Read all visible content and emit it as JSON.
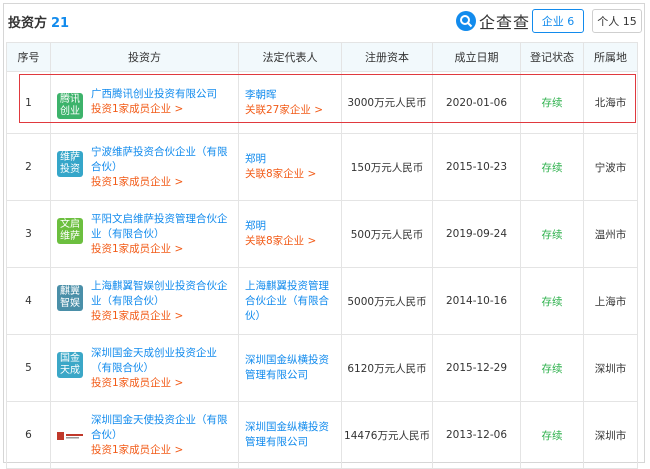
{
  "header": {
    "title": "投资方",
    "count": "21",
    "brand_text": "企查查",
    "tab_company": "企业 6",
    "tab_person": "个人 15"
  },
  "columns": [
    "序号",
    "投资方",
    "法定代表人",
    "注册资本",
    "成立日期",
    "登记状态",
    "所属地"
  ],
  "rows": [
    {
      "num": "1",
      "logo_text": "腾讯创业",
      "logo_color": "#3db36b",
      "name": "广西腾讯创业投资有限公司",
      "sub": "投资1家成员企业 >",
      "rep": "李朝晖",
      "rep_sub": "关联27家企业 >",
      "capital": "3000万元人民币",
      "date": "2020-01-06",
      "status": "存续",
      "location": "北海市"
    },
    {
      "num": "2",
      "logo_text": "维萨投资",
      "logo_color": "#35a6c9",
      "name": "宁波维萨投资合伙企业（有限合伙）",
      "sub": "投资1家成员企业 >",
      "rep": "郑明",
      "rep_sub": "关联8家企业 >",
      "capital": "150万元人民币",
      "date": "2015-10-23",
      "status": "存续",
      "location": "宁波市"
    },
    {
      "num": "3",
      "logo_text": "文启维萨",
      "logo_color": "#6cbf3f",
      "name": "平阳文启维萨投资管理合伙企业（有限合伙）",
      "sub": "投资1家成员企业 >",
      "rep": "郑明",
      "rep_sub": "关联8家企业 >",
      "capital": "500万元人民币",
      "date": "2019-09-24",
      "status": "存续",
      "location": "温州市"
    },
    {
      "num": "4",
      "logo_text": "麒翼智娱",
      "logo_color": "#4a8fa8",
      "name": "上海麒翼智娱创业投资合伙企业（有限合伙）",
      "sub": "投资1家成员企业 >",
      "rep": "上海麒翼投资管理合伙企业（有限合伙）",
      "rep_sub": "",
      "capital": "5000万元人民币",
      "date": "2014-10-16",
      "status": "存续",
      "location": "上海市"
    },
    {
      "num": "5",
      "logo_text": "国金天成",
      "logo_color": "#3ba7c7",
      "name": "深圳国金天成创业投资企业（有限合伙）",
      "sub": "投资1家成员企业 >",
      "rep": "深圳国金纵横投资管理有限公司",
      "rep_sub": "",
      "capital": "6120万元人民币",
      "date": "2015-12-29",
      "status": "存续",
      "location": "深圳市"
    },
    {
      "num": "6",
      "logo_text": "",
      "logo_color": "#c0392b",
      "name": "深圳国金天使投资企业（有限合伙）",
      "sub": "投资1家成员企业 >",
      "rep": "深圳国金纵横投资管理有限公司",
      "rep_sub": "",
      "capital": "14476万元人民币",
      "date": "2013-12-06",
      "status": "存续",
      "location": "深圳市"
    }
  ]
}
